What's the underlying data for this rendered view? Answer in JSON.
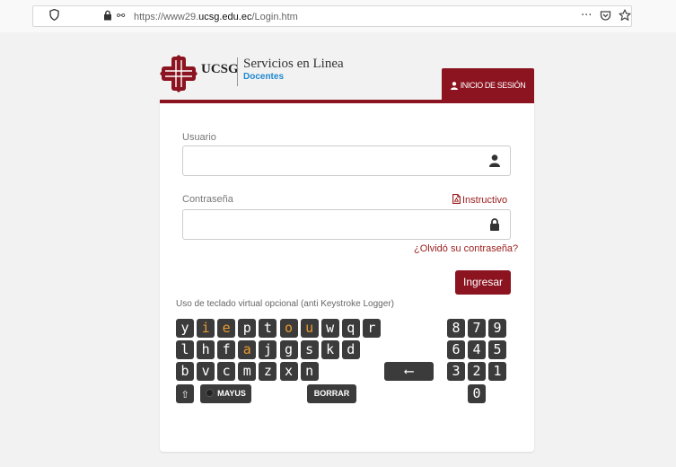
{
  "browser": {
    "url_prefix": "https://www29.",
    "url_domain": "ucsg.edu.ec",
    "url_path": "/Login.htm",
    "shield_icon": "shield-icon",
    "lock_icon": "lock-icon",
    "menu_icon": "···"
  },
  "header": {
    "brand": "UCSG",
    "title": "Servicios en Linea",
    "subtitle": "Docentes",
    "tab_label": "INICIO DE SESIÓN"
  },
  "form": {
    "usuario_label": "Usuario",
    "usuario_value": "",
    "contrasena_label": "Contraseña",
    "contrasena_value": "",
    "instructivo_link": "Instructivo",
    "forgot_link": "¿Olvidó su contraseña?",
    "submit_label": "Ingresar"
  },
  "keyboard": {
    "label": "Uso de teclado virtual opcional (anti Keystroke Logger)",
    "letter_rows": [
      [
        "y",
        "i",
        "e",
        "p",
        "t",
        "o",
        "u",
        "w",
        "q",
        "r"
      ],
      [
        "l",
        "h",
        "f",
        "a",
        "j",
        "g",
        "s",
        "k",
        "d"
      ],
      [
        "b",
        "v",
        "c",
        "m",
        "z",
        "x",
        "n"
      ]
    ],
    "number_rows": [
      [
        "8",
        "7",
        "9"
      ],
      [
        "6",
        "4",
        "5"
      ],
      [
        "3",
        "2",
        "1"
      ],
      [
        "0"
      ]
    ],
    "highlighted": [
      "i",
      "e",
      "o",
      "u",
      "a"
    ],
    "shift_symbol": "⇧",
    "mayus_label": "MAYUS",
    "borrar_label": "BORRAR",
    "backspace_symbol": "⟵"
  },
  "colors": {
    "brand_red": "#8b1420",
    "accent_blue": "#1e88d0",
    "vowel_orange": "#e89a2e",
    "key_bg": "#3b3b3b"
  }
}
